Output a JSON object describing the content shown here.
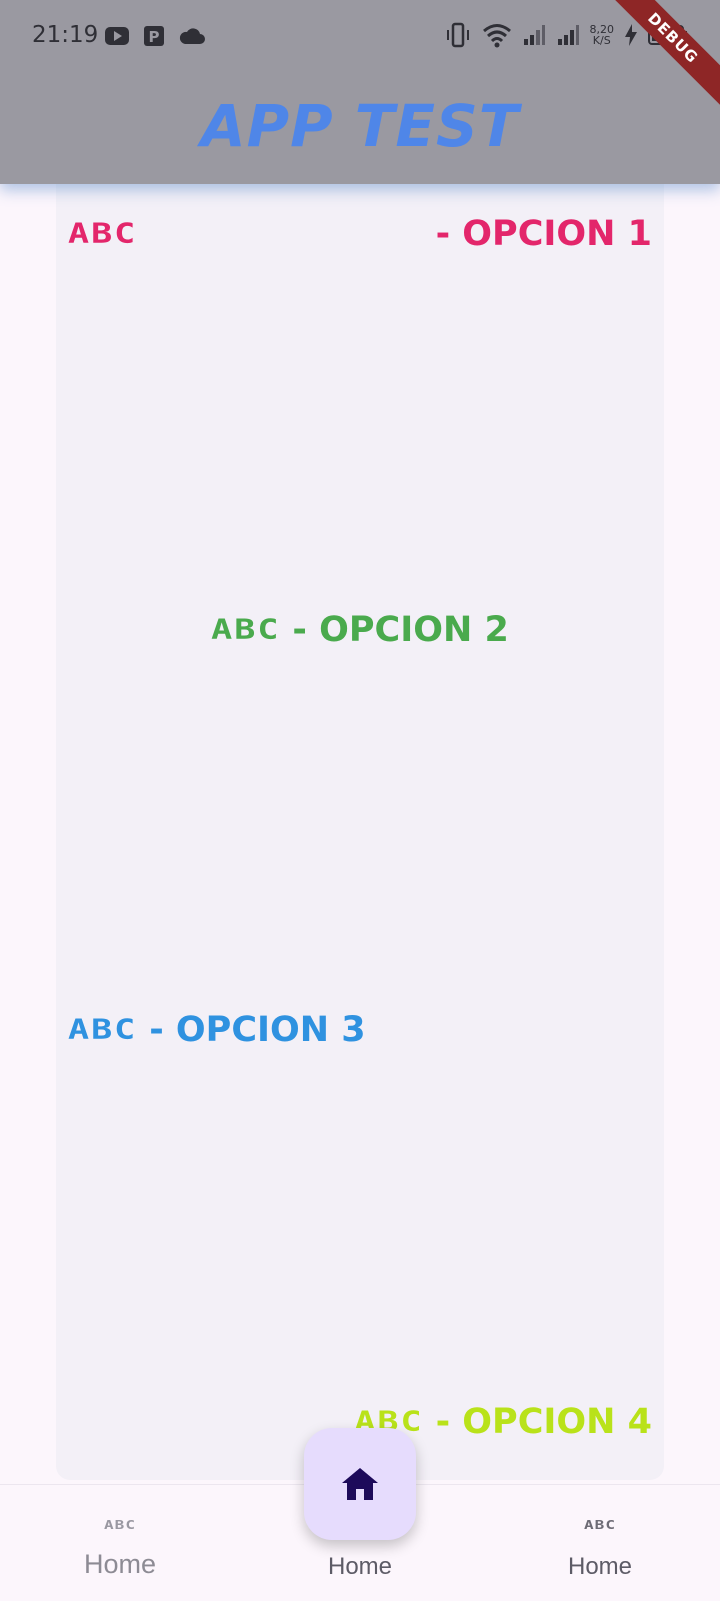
{
  "status_bar": {
    "time": "21:19",
    "speed_value": "8,20",
    "speed_unit": "K/S",
    "left_icons": [
      "youtube-icon",
      "parking-icon",
      "cloud-icon"
    ],
    "right_icons": [
      "vibrate-icon",
      "wifi-icon",
      "signal-icon",
      "signal-icon",
      "charging-icon",
      "battery-icon"
    ]
  },
  "debug_banner": "DEBUG",
  "app_bar": {
    "title": "APP TEST",
    "title_color": "#4f86e8"
  },
  "options": [
    {
      "logo": "ABC",
      "label": "- OPCION 1",
      "color": "#e3266b"
    },
    {
      "logo": "ABC",
      "label": "- OPCION 2",
      "color": "#4aaa4d"
    },
    {
      "logo": "ABC",
      "label": "- OPCION 3",
      "color": "#2f92e0"
    },
    {
      "logo": "ABC",
      "label": "- OPCION 4",
      "color": "#b9e21a"
    }
  ],
  "bottom_nav": {
    "items": [
      {
        "logo": "ABC",
        "label": "Home"
      },
      {
        "icon": "home-icon",
        "label": "Home"
      },
      {
        "logo": "ABC",
        "label": "Home"
      }
    ],
    "fab_color": "#e6dcfd"
  }
}
